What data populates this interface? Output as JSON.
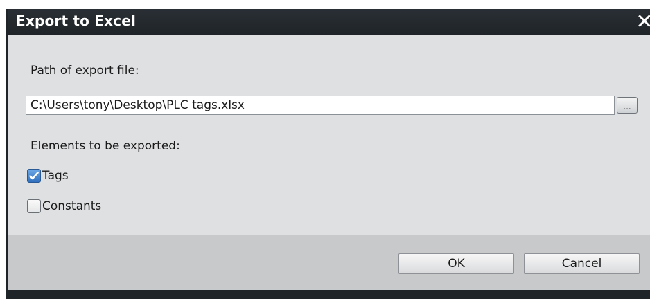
{
  "dialog": {
    "title": "Export to Excel",
    "close_glyph": "✕",
    "path_label": "Path of export file:",
    "path_value": "C:\\Users\\tony\\Desktop\\PLC tags.xlsx",
    "browse_label": "...",
    "elements_label": "Elements to be exported:",
    "options": [
      {
        "label": "Tags",
        "checked": true
      },
      {
        "label": "Constants",
        "checked": false
      }
    ],
    "ok_label": "OK",
    "cancel_label": "Cancel"
  },
  "colors": {
    "titlebar": "#1f2428",
    "body": "#dfe0e1",
    "footer": "#c8c9cb",
    "check_accent": "#2f6fbf"
  }
}
